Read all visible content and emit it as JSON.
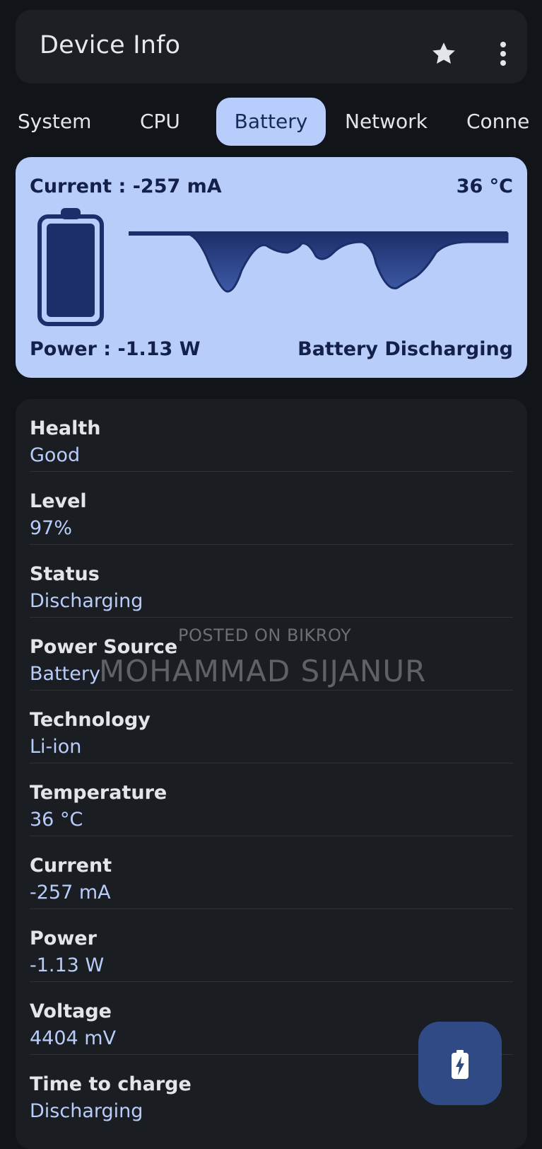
{
  "app": {
    "title": "Device Info"
  },
  "tabs": [
    {
      "label": "System"
    },
    {
      "label": "CPU"
    },
    {
      "label": "Battery",
      "active": true
    },
    {
      "label": "Network"
    },
    {
      "label": "Conne"
    }
  ],
  "hero": {
    "current": "Current : -257 mA",
    "temperature": "36 °C",
    "power": "Power : -1.13 W",
    "state": "Battery Discharging"
  },
  "details": [
    {
      "label": "Health",
      "value": "Good"
    },
    {
      "label": "Level",
      "value": "97%"
    },
    {
      "label": "Status",
      "value": "Discharging"
    },
    {
      "label": "Power Source",
      "value": "Battery"
    },
    {
      "label": "Technology",
      "value": "Li-ion"
    },
    {
      "label": "Temperature",
      "value": "36 °C"
    },
    {
      "label": "Current",
      "value": "-257 mA"
    },
    {
      "label": "Power",
      "value": "-1.13 W"
    },
    {
      "label": "Voltage",
      "value": "4404 mV"
    },
    {
      "label": "Time to charge",
      "value": "Discharging"
    }
  ],
  "watermark": {
    "line1": "POSTED ON BIKROY",
    "line2": "MOHAMMAD SIJANUR"
  },
  "icons": {
    "star": "star-icon",
    "more": "more-vert-icon",
    "battery": "battery-icon",
    "fab": "battery-charging-icon"
  },
  "colors": {
    "background": "#111418",
    "surface": "#1c1f24",
    "accent": "#b9cdfa",
    "accent_text": "#13214a",
    "fab": "#2f4a85"
  }
}
